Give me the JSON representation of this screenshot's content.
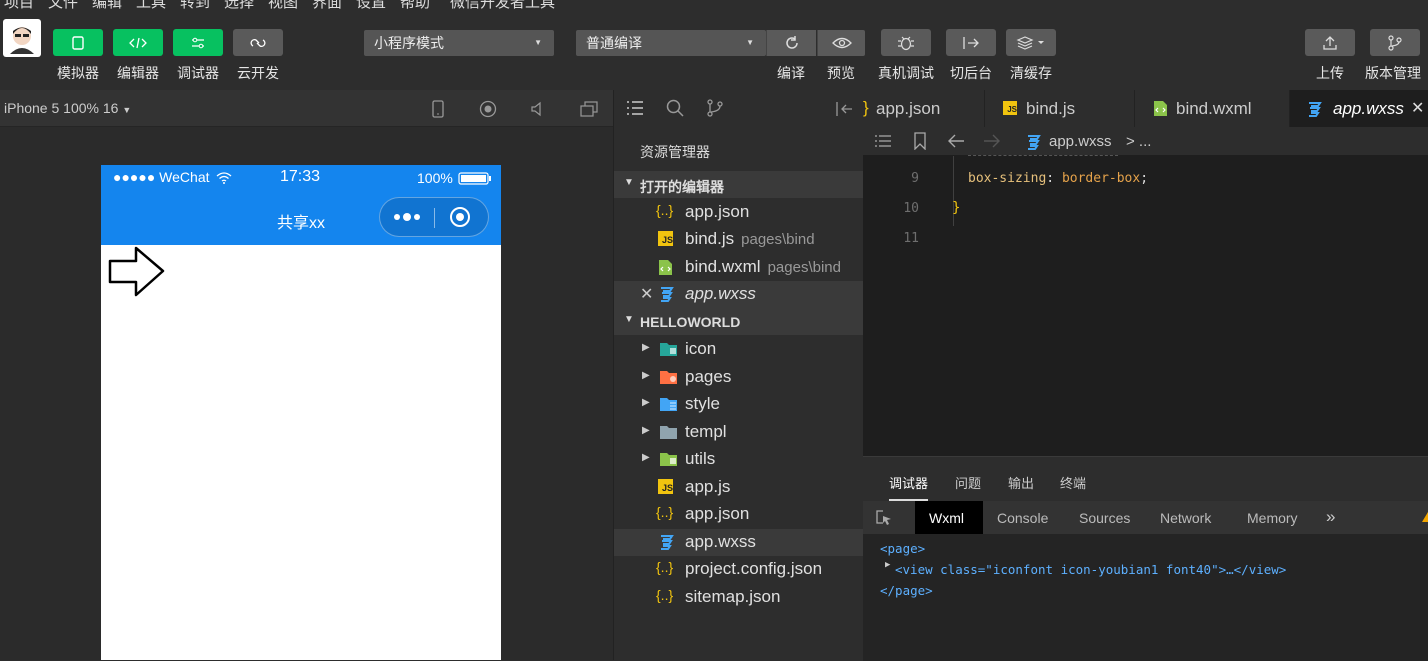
{
  "menubar": [
    "项目",
    "文件",
    "编辑",
    "工具",
    "转到",
    "选择",
    "视图",
    "界面",
    "设置",
    "帮助",
    "微信开发者工具"
  ],
  "toolbar": {
    "simulator_label": "模拟器",
    "editor_label": "编辑器",
    "debugger_label": "调试器",
    "cloud_label": "云开发",
    "mode_select": "小程序模式",
    "compile_select": "普通编译",
    "compile_label": "编译",
    "preview_label": "预览",
    "remote_debug_label": "真机调试",
    "background_label": "切后台",
    "clear_cache_label": "清缓存",
    "upload_label": "上传",
    "version_label": "版本管理"
  },
  "simulator": {
    "device": "iPhone 5 100% 16",
    "status_carrier": "●●●●● WeChat",
    "status_time": "17:33",
    "status_battery": "100%",
    "nav_title": "共享xx"
  },
  "explorer": {
    "title": "资源管理器",
    "open_editors": "打开的编辑器",
    "open_files": [
      {
        "name": "app.json",
        "sub": "",
        "icon": "json-icon"
      },
      {
        "name": "bind.js",
        "sub": "pages\\bind",
        "icon": "js-icon"
      },
      {
        "name": "bind.wxml",
        "sub": "pages\\bind",
        "icon": "wxml-icon"
      },
      {
        "name": "app.wxss",
        "sub": "",
        "icon": "wxss-icon"
      }
    ],
    "project": "HELLOWORLD",
    "folders": [
      "icon",
      "pages",
      "style",
      "templ",
      "utils"
    ],
    "files": [
      "app.js",
      "app.json",
      "app.wxss",
      "project.config.json",
      "sitemap.json"
    ]
  },
  "editor": {
    "tabs": [
      "app.json",
      "bind.js",
      "bind.wxml",
      "app.wxss"
    ],
    "breadcrumb_file": "app.wxss",
    "breadcrumb_rest": "> ...",
    "lines": [
      {
        "num": "9",
        "prop": "box-sizing",
        "val": "border-box",
        "punct": ";"
      },
      {
        "num": "10",
        "text": "}"
      },
      {
        "num": "11",
        "text": ""
      }
    ]
  },
  "devtools": {
    "top_tabs": [
      "调试器",
      "问题",
      "输出",
      "终端"
    ],
    "panel_tabs": [
      "Wxml",
      "Console",
      "Sources",
      "Network",
      "Memory",
      "»"
    ],
    "tree": [
      "<page>",
      "<view class=\"iconfont icon-youbian1 font40\">…</view>",
      "</page>"
    ]
  },
  "colors": {
    "accent_green": "#07c160",
    "nav_blue": "#1485ee",
    "js_yellow": "#f1c40f",
    "wxss_blue": "#42a5f5",
    "wxml_green": "#8bc34a"
  }
}
